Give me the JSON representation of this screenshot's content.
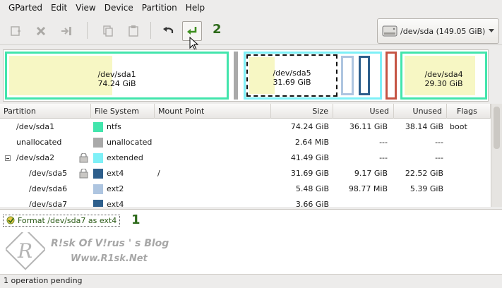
{
  "menu": [
    "GParted",
    "Edit",
    "View",
    "Device",
    "Partition",
    "Help"
  ],
  "toolbar": {
    "buttons": [
      "new-partition",
      "delete-partition",
      "resize-move",
      "copy",
      "paste",
      "undo",
      "apply"
    ],
    "step_label": "2"
  },
  "device": {
    "label": "/dev/sda   (149.05 GiB)"
  },
  "map": [
    {
      "name": "/dev/sda1",
      "size": "74.24 GiB"
    },
    {
      "name": "/dev/sda5",
      "size": "31.69 GiB"
    },
    {
      "name": "/dev/sda4",
      "size": "29.30 GiB"
    }
  ],
  "columns": [
    "Partition",
    "File System",
    "Mount Point",
    "Size",
    "Used",
    "Unused",
    "Flags"
  ],
  "rows": [
    {
      "partition": "/dev/sda1",
      "fs": "ntfs",
      "mount": "",
      "size": "74.24 GiB",
      "used": "36.11 GiB",
      "unused": "38.14 GiB",
      "flags": "boot",
      "color": "#42e5ac"
    },
    {
      "partition": "unallocated",
      "fs": "unallocated",
      "mount": "",
      "size": "2.64 MiB",
      "used": "---",
      "unused": "---",
      "flags": "",
      "color": "#a9a9a9"
    },
    {
      "partition": "/dev/sda2",
      "fs": "extended",
      "mount": "",
      "size": "41.49 GiB",
      "used": "---",
      "unused": "---",
      "flags": "",
      "color": "#7ef0f7"
    },
    {
      "partition": "/dev/sda5",
      "fs": "ext4",
      "mount": "/",
      "size": "31.69 GiB",
      "used": "9.17 GiB",
      "unused": "22.52 GiB",
      "flags": "",
      "color": "#2e5f8c"
    },
    {
      "partition": "/dev/sda6",
      "fs": "ext2",
      "mount": "",
      "size": "5.48 GiB",
      "used": "98.77 MiB",
      "unused": "5.39 GiB",
      "flags": "",
      "color": "#aec5e0"
    },
    {
      "partition": "/dev/sda7",
      "fs": "ext4",
      "mount": "",
      "size": "3.66 GiB",
      "used": "",
      "unused": "",
      "flags": "",
      "color": "#2e5f8c"
    }
  ],
  "pending": {
    "operation": "Format /dev/sda7 as ext4",
    "step_label": "1"
  },
  "watermark": {
    "title": "R!sk Of V!rus ' s Blog",
    "url": "Www.R1sk.Net"
  },
  "status": "1 operation pending"
}
